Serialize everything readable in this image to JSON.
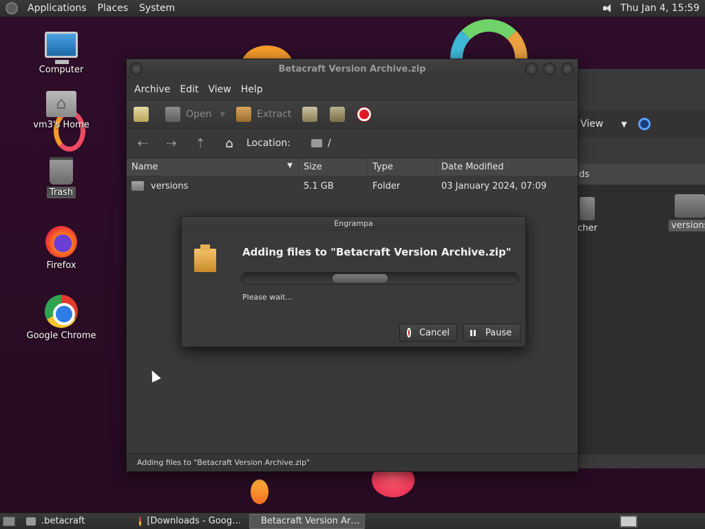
{
  "top_panel": {
    "menus": [
      "Applications",
      "Places",
      "System"
    ],
    "clock": "Thu Jan  4, 15:59"
  },
  "desktop_icons": [
    {
      "label": "Computer",
      "icon": "computer-icon"
    },
    {
      "label": "vm3's Home",
      "icon": "home-folder-icon"
    },
    {
      "label": "Trash",
      "icon": "trash-icon"
    },
    {
      "label": "Firefox",
      "icon": "firefox-icon"
    },
    {
      "label": "Google Chrome",
      "icon": "chrome-icon"
    }
  ],
  "background_window": {
    "view_label": "View",
    "header_partial": "ds",
    "items": [
      {
        "label": "cher"
      },
      {
        "label": "versions"
      }
    ]
  },
  "window": {
    "title": "Betacraft Version Archive.zip",
    "menu": [
      "Archive",
      "Edit",
      "View",
      "Help"
    ],
    "toolbar": {
      "open_label": "Open",
      "extract_label": "Extract"
    },
    "location_label": "Location:",
    "location_path": "/",
    "columns": {
      "name": "Name",
      "size": "Size",
      "type": "Type",
      "modified": "Date Modified"
    },
    "rows": [
      {
        "name": "versions",
        "size": "5.1 GB",
        "type": "Folder",
        "modified": "03 January 2024, 07:09"
      }
    ],
    "status": "Adding files to \"Betacraft Version Archive.zip\""
  },
  "dialog": {
    "title": "Engrampa",
    "heading": "Adding files to \"Betacraft Version Archive.zip\"",
    "message": "Please wait…",
    "cancel_label": "Cancel",
    "pause_label": "Pause"
  },
  "taskbar": {
    "tasks": [
      {
        "label": ".betacraft",
        "icon": "folder-icon",
        "active": false
      },
      {
        "label": "[Downloads - Goog…",
        "icon": "chrome-icon",
        "active": false
      },
      {
        "label": "Betacraft Version Ar…",
        "icon": "engrampa-icon",
        "active": true
      }
    ]
  }
}
